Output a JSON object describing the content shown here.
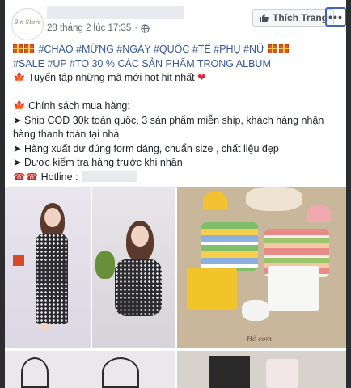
{
  "post": {
    "page_logo_text": "Bin Store",
    "timestamp": "28 tháng 2 lúc 17:35",
    "privacy_icon": "globe-icon",
    "like_page_label": "Thích Trang",
    "more_label": "•••"
  },
  "content": {
    "hashtags_line": "#CHÀO #MỪNG #NGÀY #QUỐC #TẾ #PHỤ #NỮ",
    "sale_line": "#SALE #UP #TO 30 % CÁC SẢN PHẨM TRONG ALBUM",
    "collection_line": "Tuyển tập những mã mới hot hit nhất",
    "policy_title": "Chính sách mua hàng:",
    "policy_1": "Ship COD 30k toàn quốc, 3 sản phẩm miễn ship, khách hàng nhận hàng thanh toán tại nhà",
    "policy_2": "Hàng xuất dư đúng form dáng, chuẩn size , chất liệu đẹp",
    "policy_3": "Được kiểm tra hàng trước khi nhận",
    "hotline_label": "Hotline :"
  },
  "photos": {
    "photo_3_logo": "Hè còm"
  },
  "colors": {
    "link": "#365899",
    "text": "#1d2129",
    "meta": "#606770",
    "highlight_border": "#4267b2"
  }
}
